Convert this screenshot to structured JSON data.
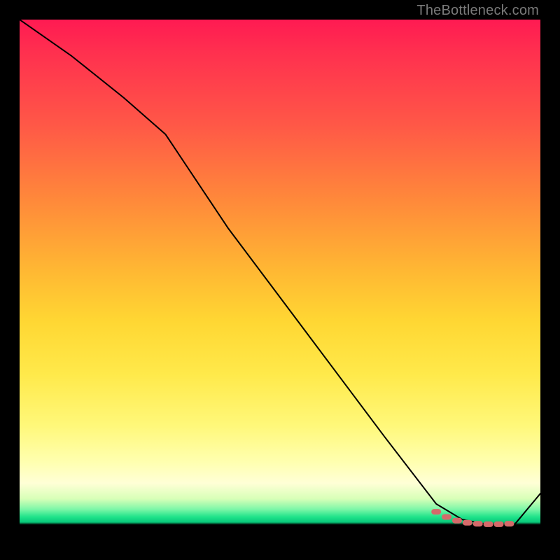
{
  "watermark": "TheBottleneck.com",
  "chart_data": {
    "type": "line",
    "title": "",
    "xlabel": "",
    "ylabel": "",
    "xlim": [
      0,
      100
    ],
    "ylim": [
      0,
      100
    ],
    "grid": false,
    "legend": false,
    "background_gradient": {
      "top_color": "#ff1a52",
      "mid_color": "#ffe94a",
      "low_band_color": "#1fe38a",
      "bottom_strip": "#000000"
    },
    "series": [
      {
        "name": "main-curve",
        "color": "#000000",
        "stroke_width": 2,
        "x": [
          0,
          10,
          20,
          28,
          40,
          55,
          70,
          80,
          85,
          90,
          95,
          100
        ],
        "y": [
          100,
          93,
          85,
          78,
          60,
          40,
          20,
          7,
          4,
          3,
          3,
          9
        ]
      },
      {
        "name": "valley-highlight",
        "type": "scatter",
        "color": "#d46a6a",
        "marker": "rounded-rect",
        "x": [
          80,
          82,
          84,
          86,
          88,
          90,
          92,
          94
        ],
        "y": [
          5.5,
          4.5,
          3.8,
          3.4,
          3.2,
          3.1,
          3.1,
          3.2
        ]
      }
    ],
    "annotations": []
  }
}
